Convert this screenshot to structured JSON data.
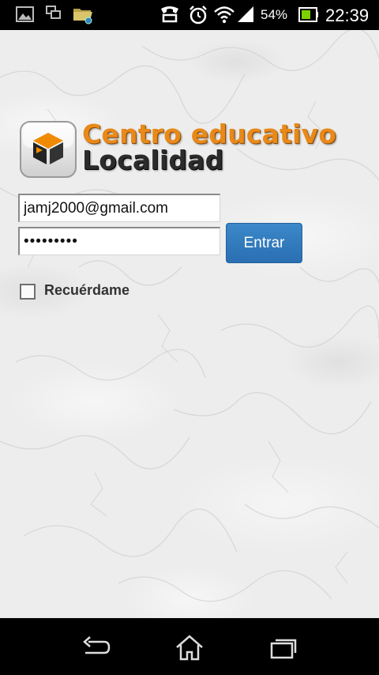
{
  "status_bar": {
    "battery_percent": "54%",
    "time": "22:39",
    "icons": [
      "image-notification-icon",
      "screen-mirror-icon",
      "folder-icon",
      "handset-icon",
      "alarm-icon",
      "wifi-icon",
      "signal-icon",
      "battery-icon"
    ]
  },
  "logo": {
    "line1": "Centro educativo",
    "line2": "Localidad",
    "colors": {
      "line1": "#e8891a",
      "line2": "#2b2b2b",
      "cube_orange": "#f08a00"
    }
  },
  "form": {
    "email_value": "jamj2000@gmail.com",
    "password_value": "•••••••••",
    "submit_label": "Entrar",
    "remember_label": "Recuérdame",
    "remember_checked": false
  },
  "colors": {
    "button": "#2f7cc1",
    "background": "#ededed"
  },
  "nav_bar": {
    "buttons": [
      "back-icon",
      "home-icon",
      "recent-apps-icon"
    ]
  }
}
